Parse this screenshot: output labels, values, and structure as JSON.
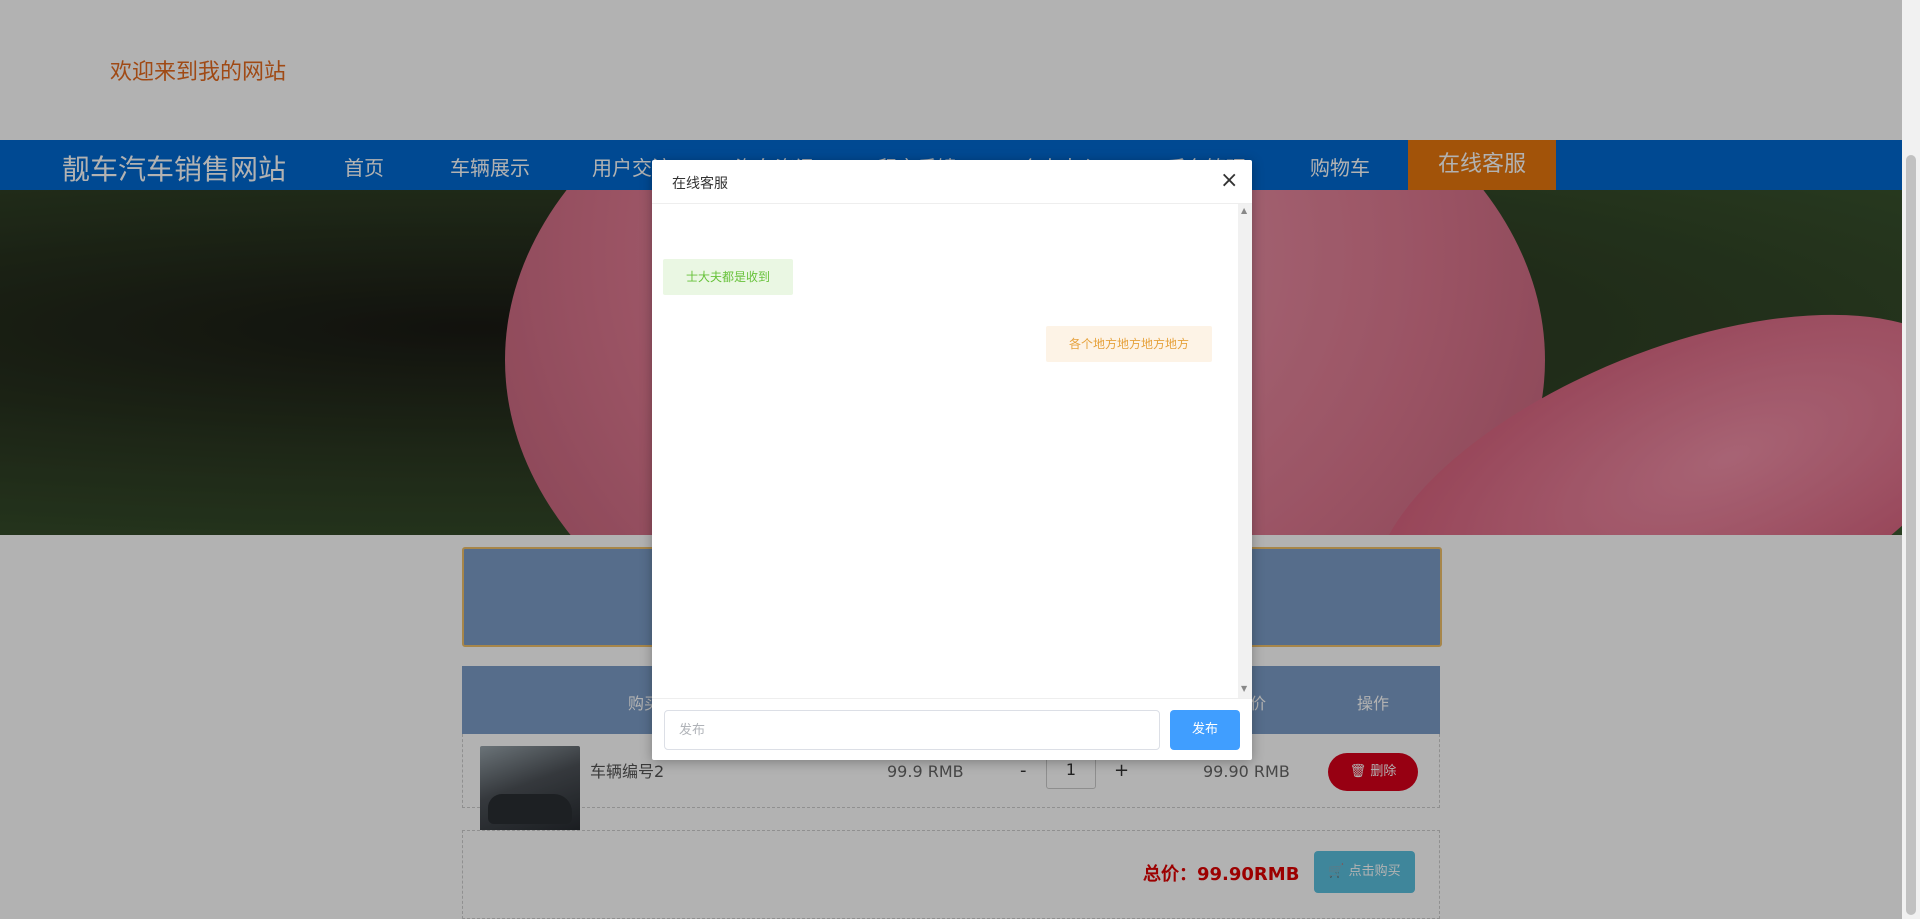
{
  "header": {
    "welcome": "欢迎来到我的网站"
  },
  "nav": {
    "brand": "靓车汽车销售网站",
    "items": [
      "首页",
      "车辆展示",
      "用户交流",
      "汽车资讯",
      "留言反馈",
      "个人中心",
      "后台管理",
      "购物车"
    ],
    "active": "在线客服"
  },
  "cart": {
    "headers": {
      "buy": "购买",
      "price": "价",
      "action": "操作"
    },
    "item": {
      "name": "车辆编号2",
      "unit_price": "99.9 RMB",
      "qty_minus": "-",
      "qty": "1",
      "qty_plus": "+",
      "subtotal": "99.90 RMB",
      "delete": "删除"
    },
    "total": "总价：99.90RMB",
    "buy_button": "点击购买"
  },
  "dialog": {
    "title": "在线客服",
    "close": "×",
    "messages": [
      {
        "side": "left",
        "text": "士大夫都是收到"
      },
      {
        "side": "right",
        "text": "各个地方地方地方地方"
      }
    ],
    "input_placeholder": "发布",
    "send_label": "发布"
  },
  "colors": {
    "nav_bg": "#0069d1",
    "active_tab": "#e8780d",
    "send_btn": "#409eff",
    "delete_btn": "#d9001b",
    "buy_btn": "#5bc0de"
  }
}
